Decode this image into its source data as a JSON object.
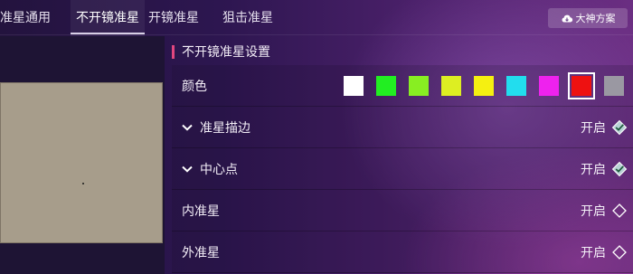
{
  "tabs": [
    {
      "label": "准星通用",
      "active": false
    },
    {
      "label": "不开镜准星",
      "active": true
    },
    {
      "label": "开镜准星",
      "active": false
    },
    {
      "label": "狙击准星",
      "active": false
    }
  ],
  "plan_button": {
    "label": "大神方案",
    "icon": "cloud-download-icon"
  },
  "section": {
    "title": "不开镜准星设置",
    "accent_color": "#e2477f"
  },
  "color_row": {
    "label": "颜色",
    "swatches": [
      "#ffffff",
      "#22ee22",
      "#88ee22",
      "#ddee22",
      "#f5f011",
      "#22ddee",
      "#ee22ee",
      "#ee1111",
      "#9a98a2"
    ],
    "selected_index": 7
  },
  "rows": [
    {
      "label": "准星描边",
      "value": "开启",
      "expandable": true,
      "checked": true
    },
    {
      "label": "中心点",
      "value": "开启",
      "expandable": true,
      "checked": true
    },
    {
      "label": "内准星",
      "value": "开启",
      "expandable": false,
      "checked": false
    },
    {
      "label": "外准星",
      "value": "开启",
      "expandable": false,
      "checked": false
    }
  ]
}
